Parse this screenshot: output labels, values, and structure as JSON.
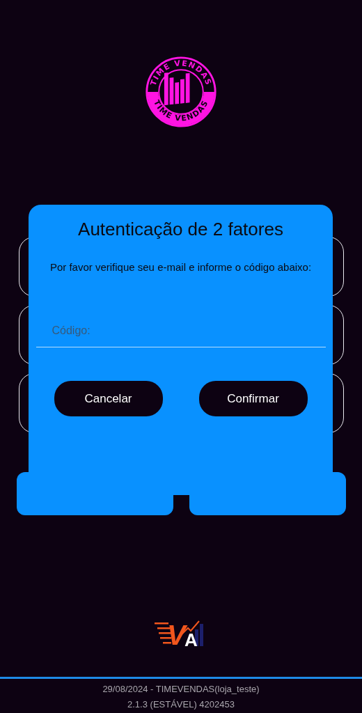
{
  "logo": {
    "top_text": "TIME VENDAS",
    "bottom_text": "TIME VENDAS"
  },
  "dialog": {
    "title": "Autenticação de 2 fatores",
    "message": "Por favor verifique seu e-mail e informe o código abaixo:",
    "code_field": {
      "placeholder": "Código:"
    },
    "buttons": [
      "Cancelar",
      "Confirmar"
    ]
  },
  "brand_logo": {
    "letters": [
      "V",
      "A"
    ]
  },
  "footer": {
    "lines": [
      "29/08/2024 - TIMEVENDAS(loja_teste)",
      "2.1.3 (ESTÁVEL) 4202453"
    ]
  }
}
